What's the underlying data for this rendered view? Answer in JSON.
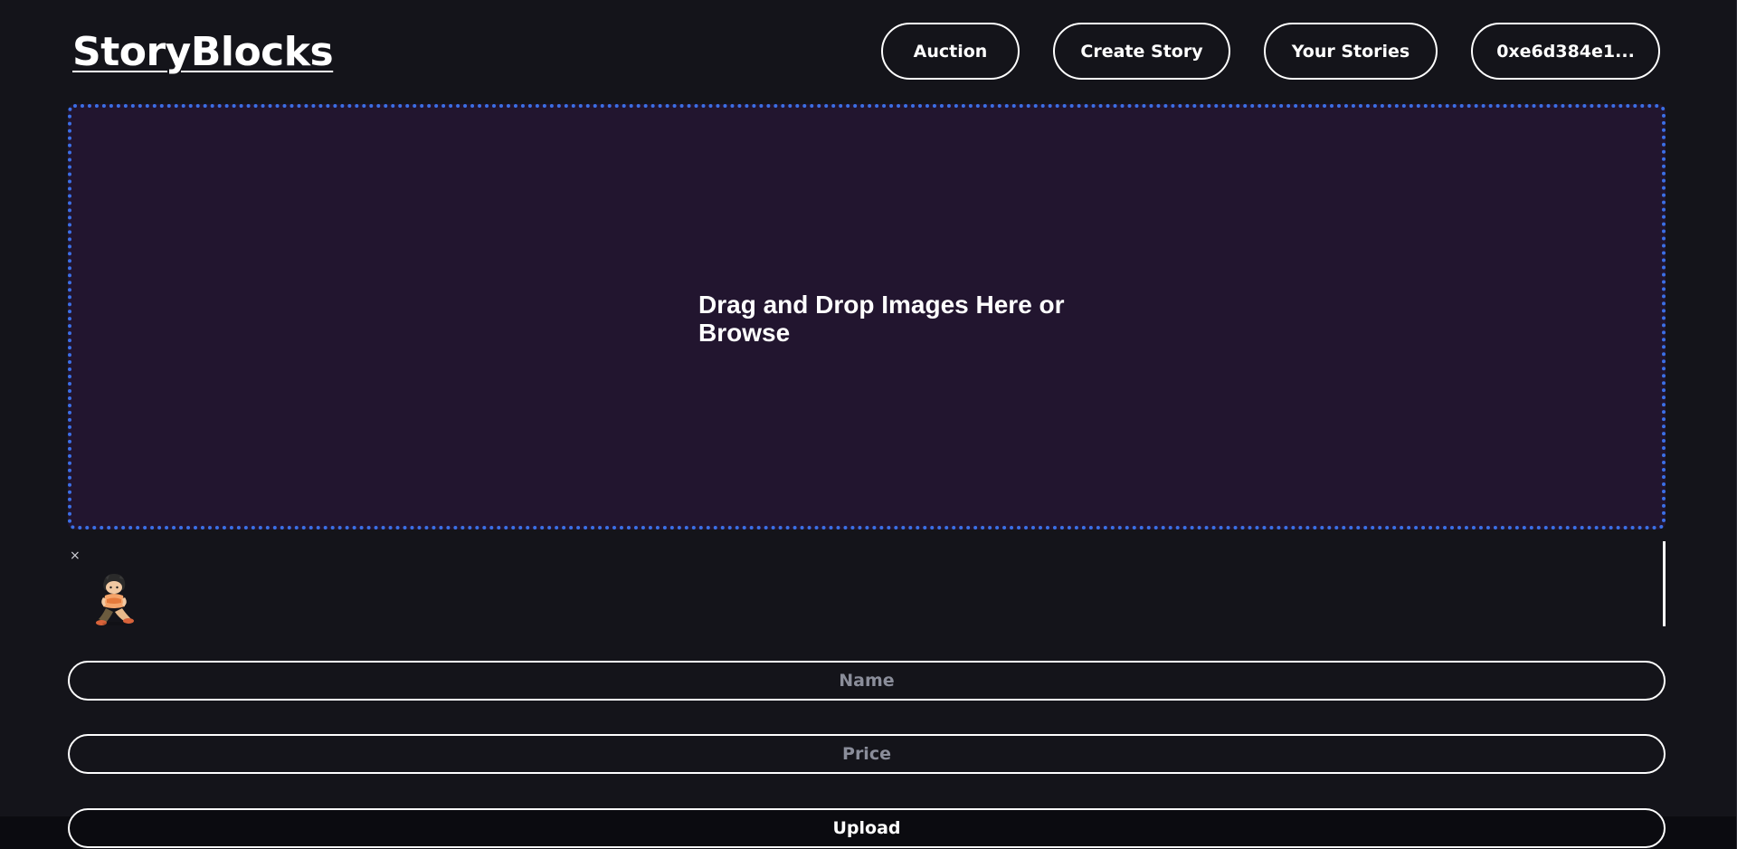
{
  "header": {
    "logo": "StoryBlocks",
    "nav": {
      "auction": "Auction",
      "create_story": "Create Story",
      "your_stories": "Your Stories",
      "wallet": "0xe6d384e1..."
    }
  },
  "dropzone": {
    "text": "Drag and Drop Images Here or Browse",
    "border_color": "#3b6fe6",
    "background_color": "#22152f"
  },
  "preview": {
    "remove_label": "×",
    "thumbnail_icon": "character-thumbnail"
  },
  "form": {
    "name_placeholder": "Name",
    "price_placeholder": "Price",
    "upload_label": "Upload"
  }
}
